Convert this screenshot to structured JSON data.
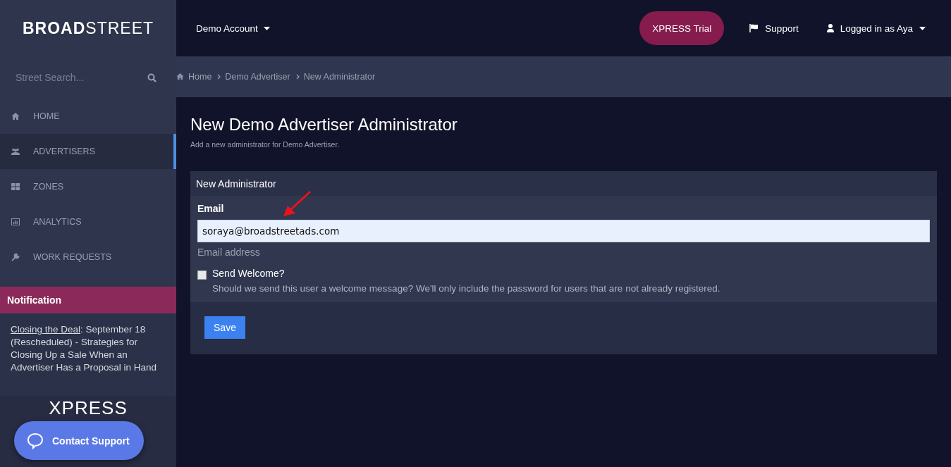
{
  "logo": "**BROAD**STREET",
  "account_menu": {
    "label": "Demo Account"
  },
  "top_nav": {
    "trial_button": "XPRESS Trial",
    "support": "Support",
    "user": "Logged in as Aya"
  },
  "search": {
    "placeholder": "Street Search..."
  },
  "sidebar": {
    "items": [
      {
        "label": "HOME",
        "kind": "home",
        "selected": false
      },
      {
        "label": "ADVERTISERS",
        "kind": "users",
        "selected": true
      },
      {
        "label": "ZONES",
        "kind": "grid",
        "selected": false
      },
      {
        "label": "ANALYTICS",
        "kind": "chart",
        "selected": false
      },
      {
        "label": "WORK REQUESTS",
        "kind": "wrench",
        "selected": false
      }
    ]
  },
  "notification": {
    "title": "Notification",
    "link": "Closing the Deal",
    "text": ": September 18 (Rescheduled) - Strategies for Closing Up a Sale When an Advertiser Has a Proposal in Hand"
  },
  "promo_text": "XPRESS",
  "contact_support": "Contact Support",
  "breadcrumb": [
    "Home",
    "Demo Advertiser",
    "New Administrator"
  ],
  "page": {
    "title": "New Demo Advertiser Administrator",
    "subtitle": "Add a new administrator for Demo Advertiser."
  },
  "form": {
    "heading": "New Administrator",
    "email_label": "Email",
    "email_value": "soraya@broadstreetads.com",
    "email_help": "Email address",
    "send_welcome": {
      "label": "Send Welcome?",
      "checked": false,
      "help": "Should we send this user a welcome message? We'll only include the password for users that are not already registered."
    },
    "save": "Save"
  }
}
